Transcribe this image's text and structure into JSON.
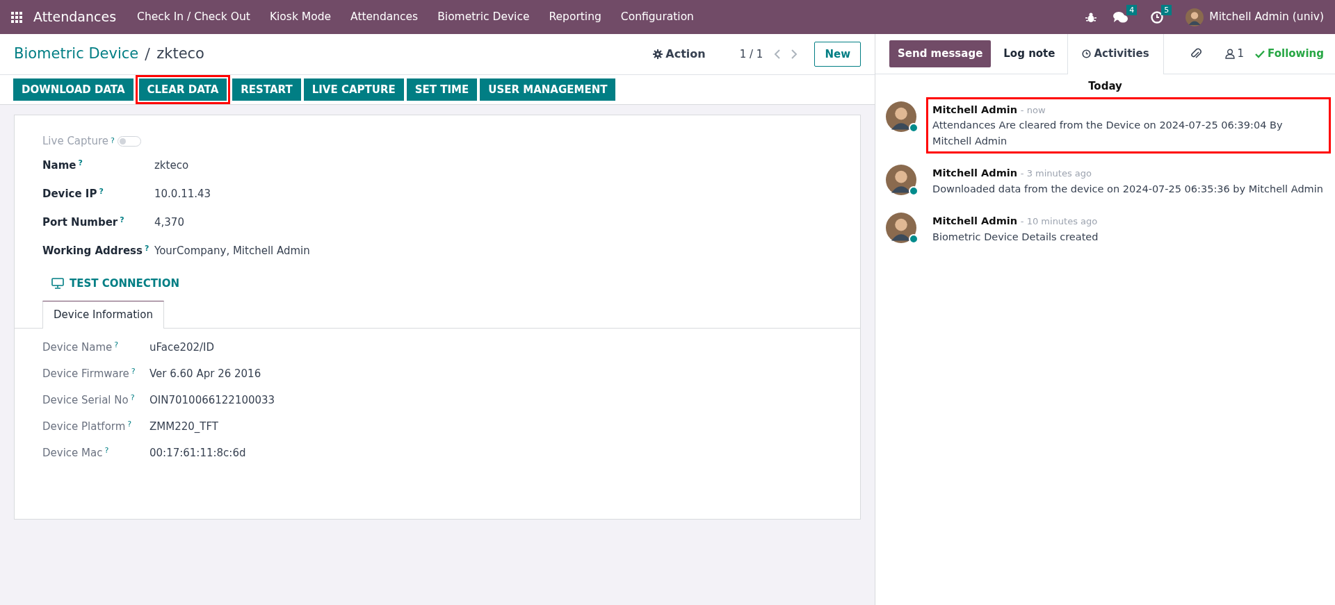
{
  "navbar": {
    "app": "Attendances",
    "menus": [
      "Check In / Check Out",
      "Kiosk Mode",
      "Attendances",
      "Biometric Device",
      "Reporting",
      "Configuration"
    ],
    "messages_count": "4",
    "activities_count": "5",
    "user": "Mitchell Admin (univ)"
  },
  "breadcrumb": {
    "parent": "Biometric Device",
    "current": "zkteco"
  },
  "action": "Action",
  "pager": "1 / 1",
  "new_button": "New",
  "header_buttons": [
    {
      "label": "DOWNLOAD DATA",
      "highlighted": false
    },
    {
      "label": "CLEAR DATA",
      "highlighted": true
    },
    {
      "label": "RESTART",
      "highlighted": false
    },
    {
      "label": "LIVE CAPTURE",
      "highlighted": false
    },
    {
      "label": "SET TIME",
      "highlighted": false
    },
    {
      "label": "USER MANAGEMENT",
      "highlighted": false
    }
  ],
  "form": {
    "live_capture": {
      "label": "Live Capture",
      "tooltip": "?",
      "on": false
    },
    "fields": [
      {
        "label": "Name",
        "tooltip": "?",
        "value": "zkteco"
      },
      {
        "label": "Device IP",
        "tooltip": "?",
        "value": "10.0.11.43"
      },
      {
        "label": "Port Number",
        "tooltip": "?",
        "value": "4,370"
      },
      {
        "label": "Working Address",
        "tooltip": "?",
        "value": "YourCompany, Mitchell Admin"
      }
    ],
    "test_connection": "TEST CONNECTION",
    "tabs": [
      {
        "label": "Device Information",
        "selected": true
      }
    ],
    "info_fields": [
      {
        "label": "Device Name",
        "tooltip": "?",
        "value": "uFace202/ID"
      },
      {
        "label": "Device Firmware",
        "tooltip": "?",
        "value": "Ver 6.60 Apr 26 2016"
      },
      {
        "label": "Device Serial No",
        "tooltip": "?",
        "value": "OIN7010066122100033"
      },
      {
        "label": "Device Platform",
        "tooltip": "?",
        "value": "ZMM220_TFT"
      },
      {
        "label": "Device Mac",
        "tooltip": "?",
        "value": "00:17:61:11:8c:6d"
      }
    ]
  },
  "chatter": {
    "send_message": "Send message",
    "log_note": "Log note",
    "activities": "Activities",
    "followers_count": "1",
    "following": "Following",
    "day": "Today",
    "messages": [
      {
        "author": "Mitchell Admin",
        "time": "- now",
        "body": "Attendances Are cleared from the Device on 2024-07-25 06:39:04 By Mitchell Admin",
        "online": true,
        "highlighted": true
      },
      {
        "author": "Mitchell Admin",
        "time": "- 3 minutes ago",
        "body": "Downloaded data from the device on 2024-07-25 06:35:36 by Mitchell Admin",
        "online": true,
        "highlighted": false
      },
      {
        "author": "Mitchell Admin",
        "time": "- 10 minutes ago",
        "body": "Biometric Device Details created",
        "online": true,
        "highlighted": false
      }
    ]
  }
}
